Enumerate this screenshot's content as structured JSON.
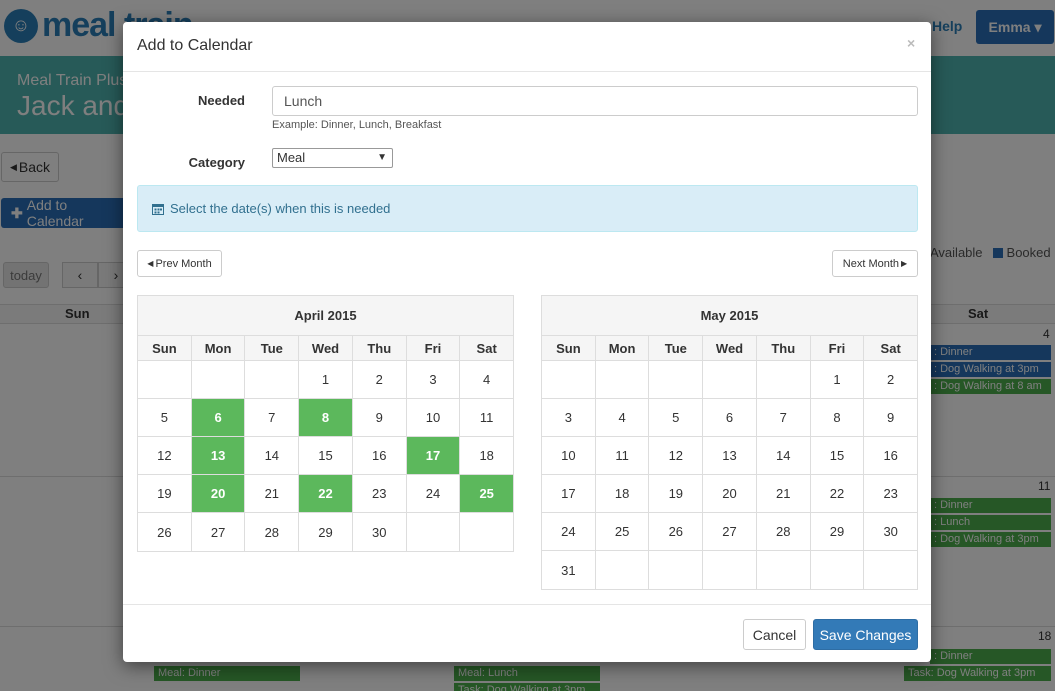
{
  "background": {
    "logo_text": "meal train",
    "help": "Help",
    "user": "Emma ▾",
    "banner_sub": "Meal Train Plus",
    "banner_title": "Jack and",
    "back": "Back",
    "add": "Add to Calendar",
    "today": "today",
    "legend_available": "Available",
    "legend_booked": "Booked",
    "weekdays": [
      "Sun",
      "Sat"
    ],
    "day_nums": [
      "4",
      "11",
      "18"
    ],
    "events": [
      {
        "text": ": Dinner",
        "color": "blue"
      },
      {
        "text": ": Dog Walking at 3pm",
        "color": "blue"
      },
      {
        "text": ": Dog Walking at 8 am",
        "color": "green"
      },
      {
        "text": ": Dinner",
        "color": "green"
      },
      {
        "text": ": Lunch",
        "color": "green"
      },
      {
        "text": ": Dog Walking at 3pm",
        "color": "green"
      },
      {
        "text": ": Dinner",
        "color": "green"
      },
      {
        "text": "Task: Dog Walking at 3pm",
        "color": "green"
      },
      {
        "text": "Meal: Dinner",
        "color": "green"
      },
      {
        "text": "Meal: Lunch",
        "color": "green"
      },
      {
        "text": "Task: Dog Walking at 3pm",
        "color": "green"
      }
    ]
  },
  "modal": {
    "title": "Add to Calendar",
    "close": "×",
    "needed_label": "Needed",
    "needed_value": "Lunch",
    "needed_help": "Example: Dinner, Lunch, Breakfast",
    "category_label": "Category",
    "category_value": "Meal",
    "alert": "Select the date(s) when this is needed",
    "prev_month": "Prev Month",
    "next_month": "Next Month",
    "cancel": "Cancel",
    "save": "Save Changes"
  },
  "calendars": [
    {
      "title": "April 2015",
      "weekdays": [
        "Sun",
        "Mon",
        "Tue",
        "Wed",
        "Thu",
        "Fri",
        "Sat"
      ],
      "weeks": [
        [
          "",
          "",
          "",
          "1",
          "2",
          "3",
          "4"
        ],
        [
          "5",
          "6",
          "7",
          "8",
          "9",
          "10",
          "11"
        ],
        [
          "12",
          "13",
          "14",
          "15",
          "16",
          "17",
          "18"
        ],
        [
          "19",
          "20",
          "21",
          "22",
          "23",
          "24",
          "25"
        ],
        [
          "26",
          "27",
          "28",
          "29",
          "30",
          "",
          ""
        ]
      ],
      "selected": [
        "6",
        "8",
        "13",
        "17",
        "20",
        "22",
        "25"
      ]
    },
    {
      "title": "May 2015",
      "weekdays": [
        "Sun",
        "Mon",
        "Tue",
        "Wed",
        "Thu",
        "Fri",
        "Sat"
      ],
      "weeks": [
        [
          "",
          "",
          "",
          "",
          "",
          "1",
          "2"
        ],
        [
          "3",
          "4",
          "5",
          "6",
          "7",
          "8",
          "9"
        ],
        [
          "10",
          "11",
          "12",
          "13",
          "14",
          "15",
          "16"
        ],
        [
          "17",
          "18",
          "19",
          "20",
          "21",
          "22",
          "23"
        ],
        [
          "24",
          "25",
          "26",
          "27",
          "28",
          "29",
          "30"
        ],
        [
          "31",
          "",
          "",
          "",
          "",
          "",
          ""
        ]
      ],
      "selected": []
    }
  ],
  "colors": {
    "selected": "#5cb85c",
    "primary": "#2a6fb8",
    "alert_bg": "#d9edf7"
  }
}
